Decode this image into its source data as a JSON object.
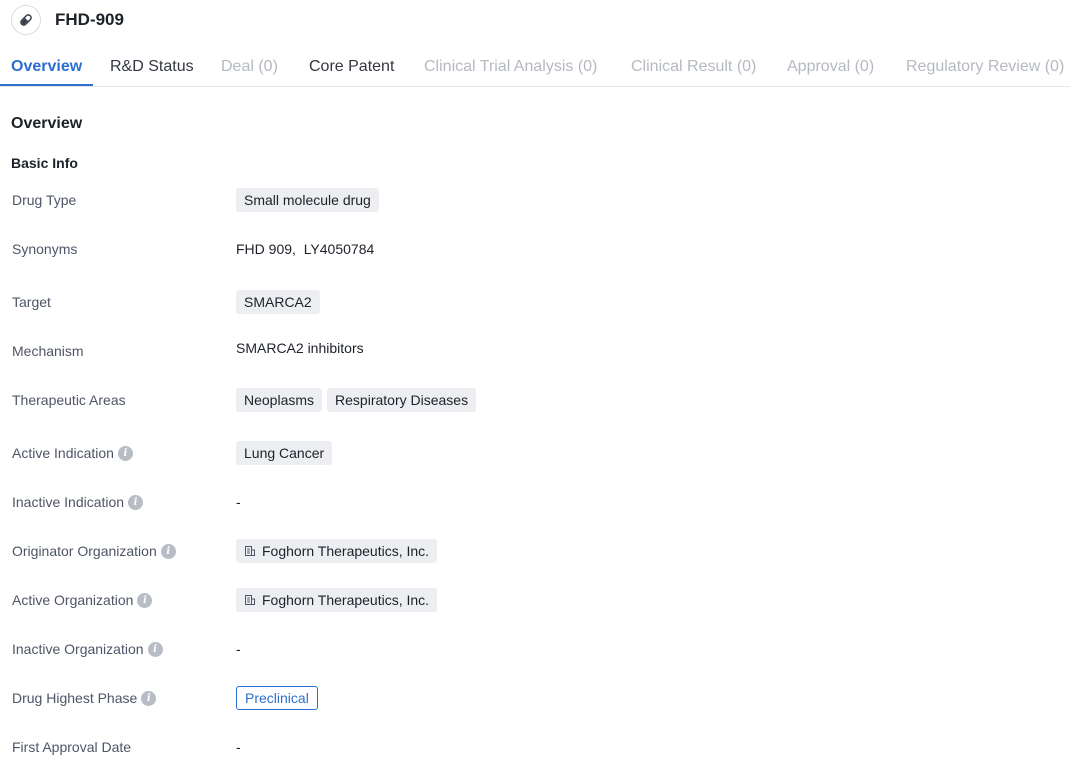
{
  "header": {
    "title": "FHD-909",
    "icon": "pill-icon"
  },
  "tabs": [
    {
      "label": "Overview",
      "state": "active"
    },
    {
      "label": "R&D Status",
      "state": "enabled"
    },
    {
      "label": "Deal (0)",
      "state": "disabled"
    },
    {
      "label": "Core Patent",
      "state": "enabled"
    },
    {
      "label": "Clinical Trial Analysis (0)",
      "state": "disabled"
    },
    {
      "label": "Clinical Result (0)",
      "state": "disabled"
    },
    {
      "label": "Approval (0)",
      "state": "disabled"
    },
    {
      "label": "Regulatory Review (0)",
      "state": "disabled"
    }
  ],
  "overview": {
    "title": "Overview",
    "basic_info_title": "Basic Info",
    "fields": {
      "drug_type": {
        "label": "Drug Type",
        "values": [
          "Small molecule drug"
        ]
      },
      "synonyms": {
        "label": "Synonyms",
        "text": "FHD 909,  LY4050784"
      },
      "target": {
        "label": "Target",
        "values": [
          "SMARCA2"
        ]
      },
      "mechanism": {
        "label": "Mechanism",
        "text": "SMARCA2 inhibitors"
      },
      "therapeutic_areas": {
        "label": "Therapeutic Areas",
        "values": [
          "Neoplasms",
          "Respiratory Diseases"
        ]
      },
      "active_indication": {
        "label": "Active Indication",
        "values": [
          "Lung Cancer"
        ]
      },
      "inactive_indication": {
        "label": "Inactive Indication",
        "text": "-"
      },
      "originator_organization": {
        "label": "Originator Organization",
        "values": [
          "Foghorn Therapeutics, Inc."
        ]
      },
      "active_organization": {
        "label": "Active Organization",
        "values": [
          "Foghorn Therapeutics, Inc."
        ]
      },
      "inactive_organization": {
        "label": "Inactive Organization",
        "text": "-"
      },
      "drug_highest_phase": {
        "label": "Drug Highest Phase",
        "value": "Preclinical"
      },
      "first_approval_date": {
        "label": "First Approval Date",
        "text": "-"
      }
    }
  },
  "colors": {
    "accent": "#2d6fd1",
    "chip_bg": "#edeef1",
    "disabled_text": "#b5b9c1"
  },
  "icons": {
    "info": "info-icon",
    "organization": "building-icon"
  }
}
